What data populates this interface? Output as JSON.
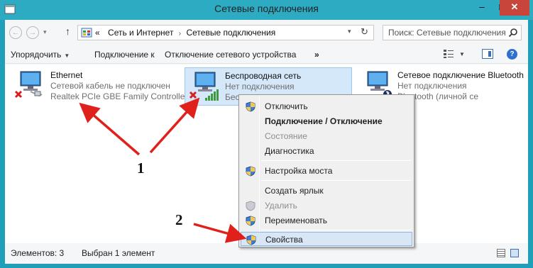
{
  "window": {
    "title": "Сетевые подключения",
    "controls": {
      "minimize": "–",
      "maximize": "□",
      "close": "✕"
    }
  },
  "nav": {
    "back_icon": "back-arrow-icon",
    "forward_icon": "forward-arrow-icon",
    "recent_icon": "chevron-down-icon",
    "up_icon": "up-arrow-icon",
    "back_glyph": "←",
    "forward_glyph": "→",
    "recent_glyph": "▾",
    "up_glyph": "↑"
  },
  "address": {
    "prefix": "«",
    "crumbs": [
      "Сеть и Интернет",
      "Сетевые подключения"
    ],
    "separator": "›",
    "dropdown_glyph": "▾",
    "refresh_glyph": "↻"
  },
  "search": {
    "placeholder": "Поиск: Сетевые подключения"
  },
  "toolbar": {
    "organize": "Упорядочить",
    "connect": "Подключение к",
    "disconnect": "Отключение сетевого устройства",
    "more": "»",
    "caret": "▼",
    "help": "?"
  },
  "connections": [
    {
      "name": "Ethernet",
      "status": "Сетевой кабель не подключен",
      "device": "Realtek PCIe GBE Family Controller",
      "icon": "wired-network-disconnected-icon"
    },
    {
      "name": "Беспроводная сеть",
      "status": "Нет подключения",
      "device": "Беспроводная сеть",
      "icon": "wireless-network-disconnected-icon",
      "selected": true
    },
    {
      "name": "Сетевое подключение Bluetooth",
      "status": "Нет подключения",
      "device": "Bluetooth (личной се",
      "icon": "bluetooth-network-icon"
    }
  ],
  "context_menu": {
    "items": [
      {
        "label": "Отключить",
        "shield": true,
        "bold": false,
        "disabled": false
      },
      {
        "label": "Подключение / Отключение",
        "shield": false,
        "bold": true,
        "disabled": false
      },
      {
        "label": "Состояние",
        "shield": false,
        "bold": false,
        "disabled": true
      },
      {
        "label": "Диагностика",
        "shield": false,
        "bold": false,
        "disabled": false
      },
      {
        "label": "Настройка моста",
        "shield": true,
        "bold": false,
        "disabled": false
      },
      {
        "label": "Создать ярлык",
        "shield": false,
        "bold": false,
        "disabled": false
      },
      {
        "label": "Удалить",
        "shield": true,
        "bold": false,
        "disabled": true
      },
      {
        "label": "Переименовать",
        "shield": true,
        "bold": false,
        "disabled": false
      },
      {
        "label": "Свойства",
        "shield": true,
        "bold": false,
        "disabled": false,
        "selected": true
      }
    ]
  },
  "status_bar": {
    "count": "Элементов: 3",
    "selection": "Выбран 1 элемент"
  },
  "annotations": {
    "label_1": "1",
    "label_2": "2",
    "arrow_color": "#e0201a"
  },
  "colors": {
    "title_bar": "#2cabc2",
    "close_button": "#c7453a",
    "selection_fill": "#d5e8f9",
    "selection_border": "#9bc8f0"
  }
}
